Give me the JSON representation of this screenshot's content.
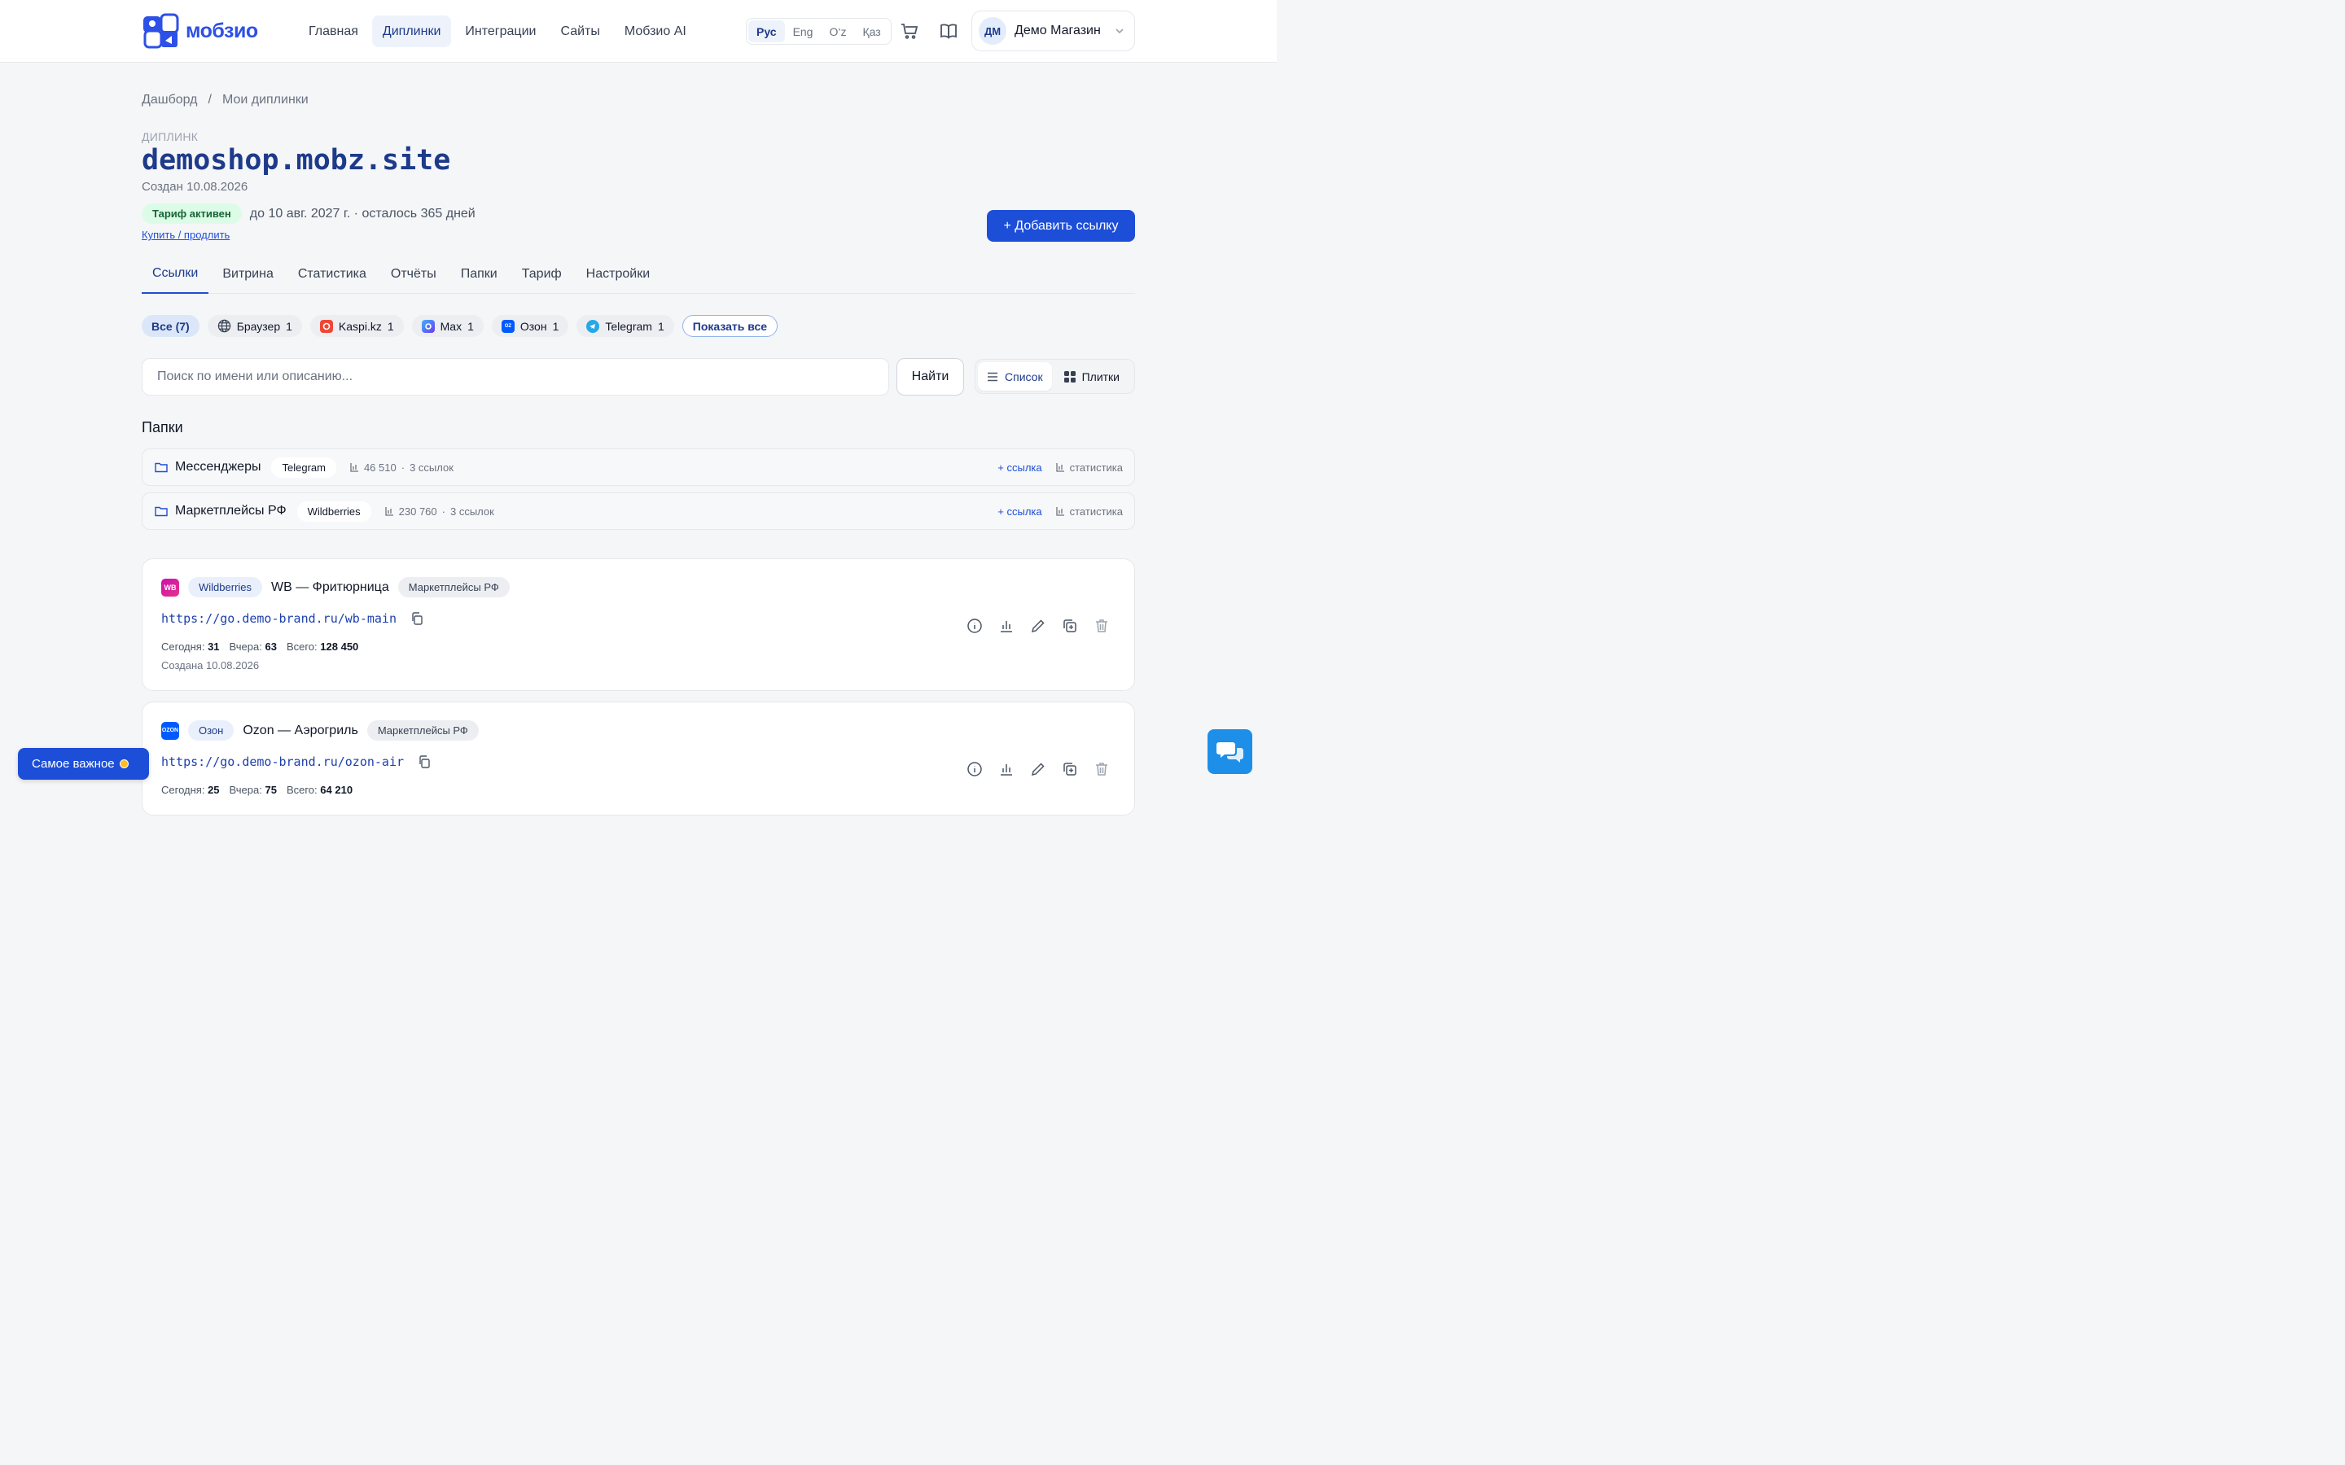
{
  "header": {
    "logo_text": "мобзио",
    "nav": [
      {
        "label": "Главная",
        "active": false
      },
      {
        "label": "Диплинки",
        "active": true
      },
      {
        "label": "Интеграции",
        "active": false
      },
      {
        "label": "Сайты",
        "active": false
      },
      {
        "label": "Мобзио AI",
        "active": false
      }
    ],
    "languages": [
      {
        "label": "Рус",
        "active": true
      },
      {
        "label": "Eng",
        "active": false
      },
      {
        "label": "O‘z",
        "active": false
      },
      {
        "label": "Қаз",
        "active": false
      }
    ],
    "user": {
      "initials": "ДМ",
      "name": "Демо Магазин"
    }
  },
  "breadcrumb": {
    "root": "Дашборд",
    "separator": "/",
    "current": "Мои диплинки"
  },
  "deeplink": {
    "kicker": "Диплинк",
    "title": "demoshop.mobz.site",
    "created": "Создан 10.08.2026",
    "tariff_badge": "Тариф активен",
    "tariff_text": "до 10 авг. 2027 г. · осталось 365 дней",
    "buy_link": "Купить / продлить",
    "add_button": "+ Добавить ссылку"
  },
  "tabs": [
    "Ссылки",
    "Витрина",
    "Статистика",
    "Отчёты",
    "Папки",
    "Тариф",
    "Настройки"
  ],
  "filters": {
    "all": "Все (7)",
    "chips": [
      {
        "label": "Браузер",
        "count": "1",
        "icon": "globe-icon",
        "color": "#ffffff"
      },
      {
        "label": "Kaspi.kz",
        "count": "1",
        "icon": "kaspi-icon",
        "color": "#f14635"
      },
      {
        "label": "Max",
        "count": "1",
        "icon": "max-icon",
        "color": "#4a5cf0"
      },
      {
        "label": "Озон",
        "count": "1",
        "icon": "ozon-icon",
        "color": "#005bff"
      },
      {
        "label": "Telegram",
        "count": "1",
        "icon": "telegram-icon",
        "color": "#27a7e7"
      }
    ],
    "show_all": "Показать все"
  },
  "search": {
    "placeholder": "Поиск по имени или описанию...",
    "button": "Найти"
  },
  "view": {
    "list": "Список",
    "tiles": "Плитки"
  },
  "folders_title": "Папки",
  "folders": [
    {
      "name": "Мессенджеры",
      "tag": "Telegram",
      "clicks": "46 510",
      "links": "3 ссылок",
      "add": "+ ссылка",
      "stats": "статистика"
    },
    {
      "name": "Маркетплейсы РФ",
      "tag": "Wildberries",
      "clicks": "230 760",
      "links": "3 ссылок",
      "add": "+ ссылка",
      "stats": "статистика"
    }
  ],
  "links": [
    {
      "brand_icon": "WB",
      "brand_color": "#cb11ab",
      "platform": "Wildberries",
      "title": "WB — Фритюрница",
      "folder": "Маркетплейсы РФ",
      "url": "https://go.demo-brand.ru/wb-main",
      "today_label": "Сегодня:",
      "today": "31",
      "yesterday_label": "Вчера:",
      "yesterday": "63",
      "total_label": "Всего:",
      "total": "128 450",
      "created": "Создана 10.08.2026"
    },
    {
      "brand_icon": "OZON",
      "brand_color": "#005bff",
      "platform": "Озон",
      "title": "Ozon — Аэрогриль",
      "folder": "Маркетплейсы РФ",
      "url": "https://go.demo-brand.ru/ozon-air",
      "today_label": "Сегодня:",
      "today": "25",
      "yesterday_label": "Вчера:",
      "yesterday": "75",
      "total_label": "Всего:",
      "total": "64 210",
      "created": ""
    }
  ],
  "important_button": "Самое важное",
  "colors": {
    "accent": "#1d4ed8",
    "title": "#1e3a8a",
    "badge_green": "#dcfce7"
  }
}
